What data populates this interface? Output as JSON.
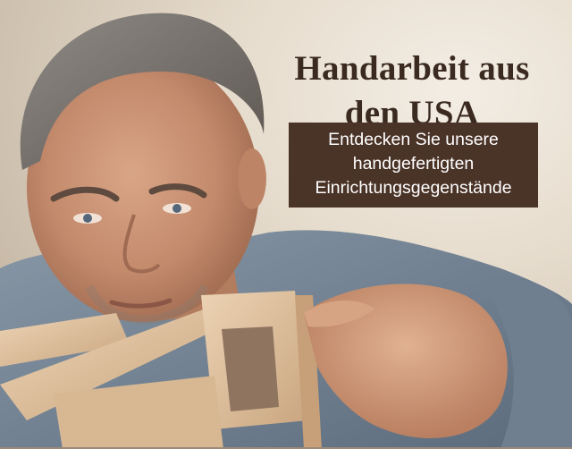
{
  "banner": {
    "headline_line1": "Handarbeit aus",
    "headline_line2": "den USA",
    "cta_line1": "Entdecken Sie unsere",
    "cta_line2": "handgefertigten",
    "cta_line3": "Einrichtungsgegenstände"
  },
  "colors": {
    "headline": "#3b2a20",
    "cta_background": "#4a3327",
    "cta_text": "#ffffff"
  }
}
